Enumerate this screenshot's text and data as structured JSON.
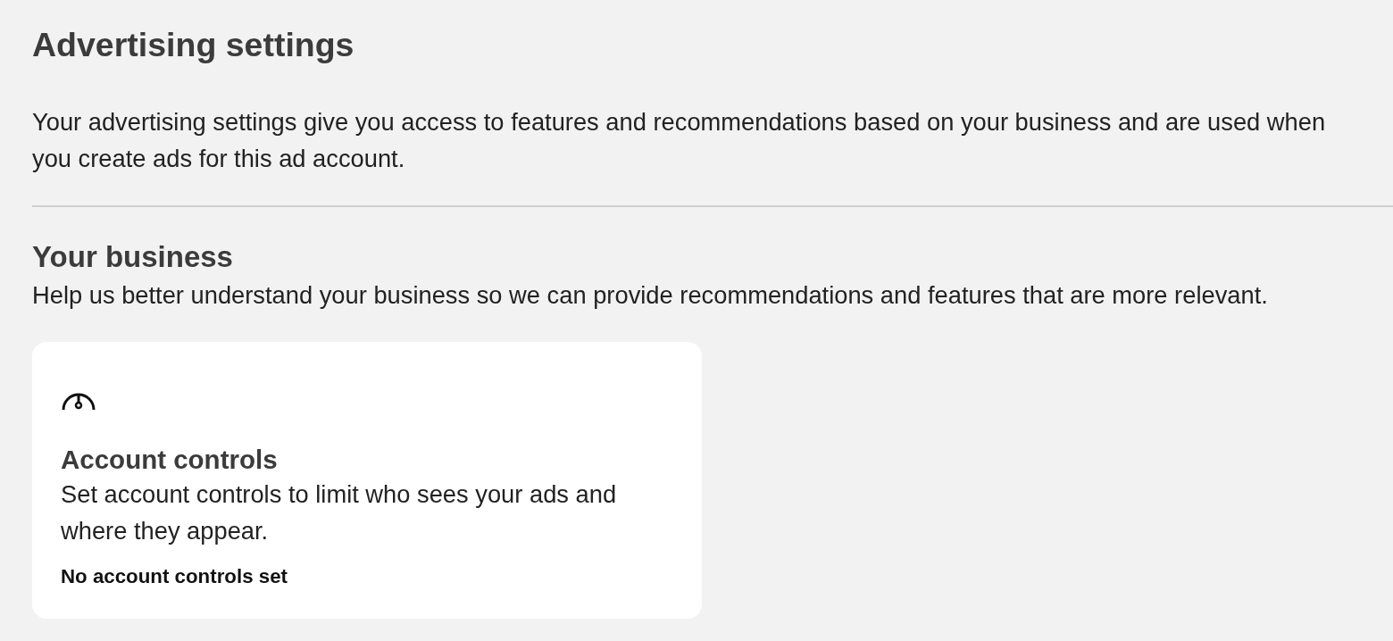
{
  "page": {
    "title": "Advertising settings",
    "description": "Your advertising settings give you access to features and recommendations based on your business and are used when you create ads for this ad account."
  },
  "section": {
    "title": "Your business",
    "description": "Help us better understand your business so we can provide recommendations and features that are more relevant."
  },
  "cards": [
    {
      "kind": "gauge",
      "title": "Account controls",
      "description": "Set account controls to limit who sees your ads and where they appear.",
      "status": "No account controls set"
    }
  ]
}
